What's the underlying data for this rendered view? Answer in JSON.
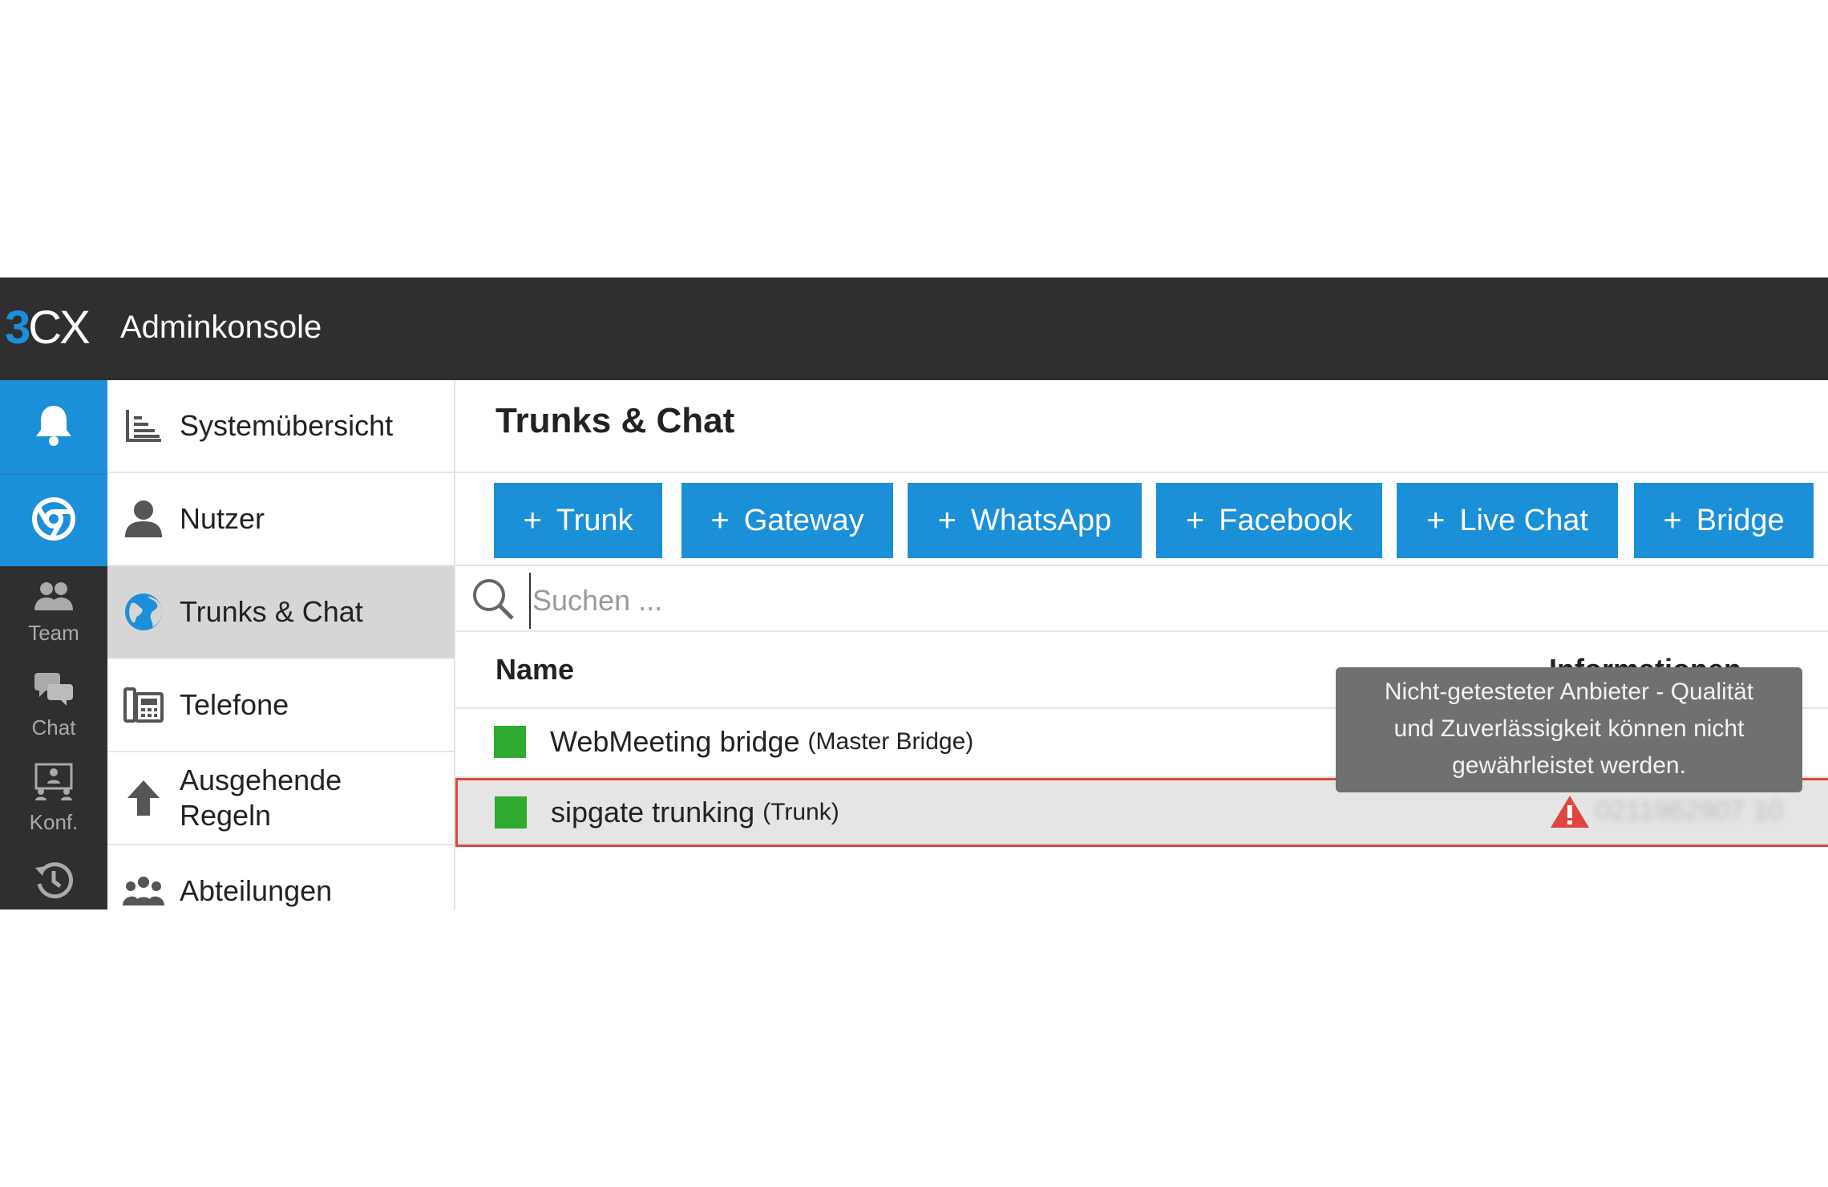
{
  "app": {
    "logo_text_3": "3",
    "logo_text_cx": "CX",
    "title": "Adminkonsole"
  },
  "rail": {
    "items": [
      {
        "icon": "bell-icon",
        "label": ""
      },
      {
        "icon": "chrome-icon",
        "label": ""
      },
      {
        "icon": "team-icon",
        "label": "Team"
      },
      {
        "icon": "chat-icon",
        "label": "Chat"
      },
      {
        "icon": "conference-icon",
        "label": "Konf."
      },
      {
        "icon": "history-icon",
        "label": ""
      }
    ]
  },
  "menu": {
    "items": [
      {
        "icon": "chart-icon",
        "label": "Systemübersicht"
      },
      {
        "icon": "user-icon",
        "label": "Nutzer"
      },
      {
        "icon": "globe-icon",
        "label": "Trunks & Chat",
        "active": true
      },
      {
        "icon": "phone-icon",
        "label": "Telefone"
      },
      {
        "icon": "arrow-up-icon",
        "label_line1": "Ausgehende",
        "label_line2": "Regeln"
      },
      {
        "icon": "group-icon",
        "label": "Abteilungen"
      }
    ]
  },
  "main": {
    "title": "Trunks & Chat",
    "buttons": [
      {
        "label": "Trunk"
      },
      {
        "label": "Gateway"
      },
      {
        "label": "WhatsApp"
      },
      {
        "label": "Facebook"
      },
      {
        "label": "Live Chat"
      },
      {
        "label": "Bridge"
      }
    ],
    "plus": "+",
    "search_placeholder": "Suchen ...",
    "columns": {
      "name": "Name",
      "info": "Informationen"
    },
    "rows": [
      {
        "name": "WebMeeting bridge",
        "type": "(Master Bridge)",
        "status_color": "#2eaa2e"
      },
      {
        "name": "sipgate trunking",
        "type": "(Trunk)",
        "status_color": "#2eaa2e",
        "info_blurred": "0211962907 10",
        "warning_icon": "warning-triangle-icon"
      }
    ],
    "tooltip": {
      "line1": "Nicht-getesteter Anbieter - Qualität",
      "line2": "und Zuverlässigkeit können nicht",
      "line3": "gewährleistet werden."
    }
  },
  "colors": {
    "accent": "#1b8fd8",
    "topbar": "#2f2f2f",
    "status_ok": "#2eaa2e",
    "warning": "#e0463e"
  }
}
